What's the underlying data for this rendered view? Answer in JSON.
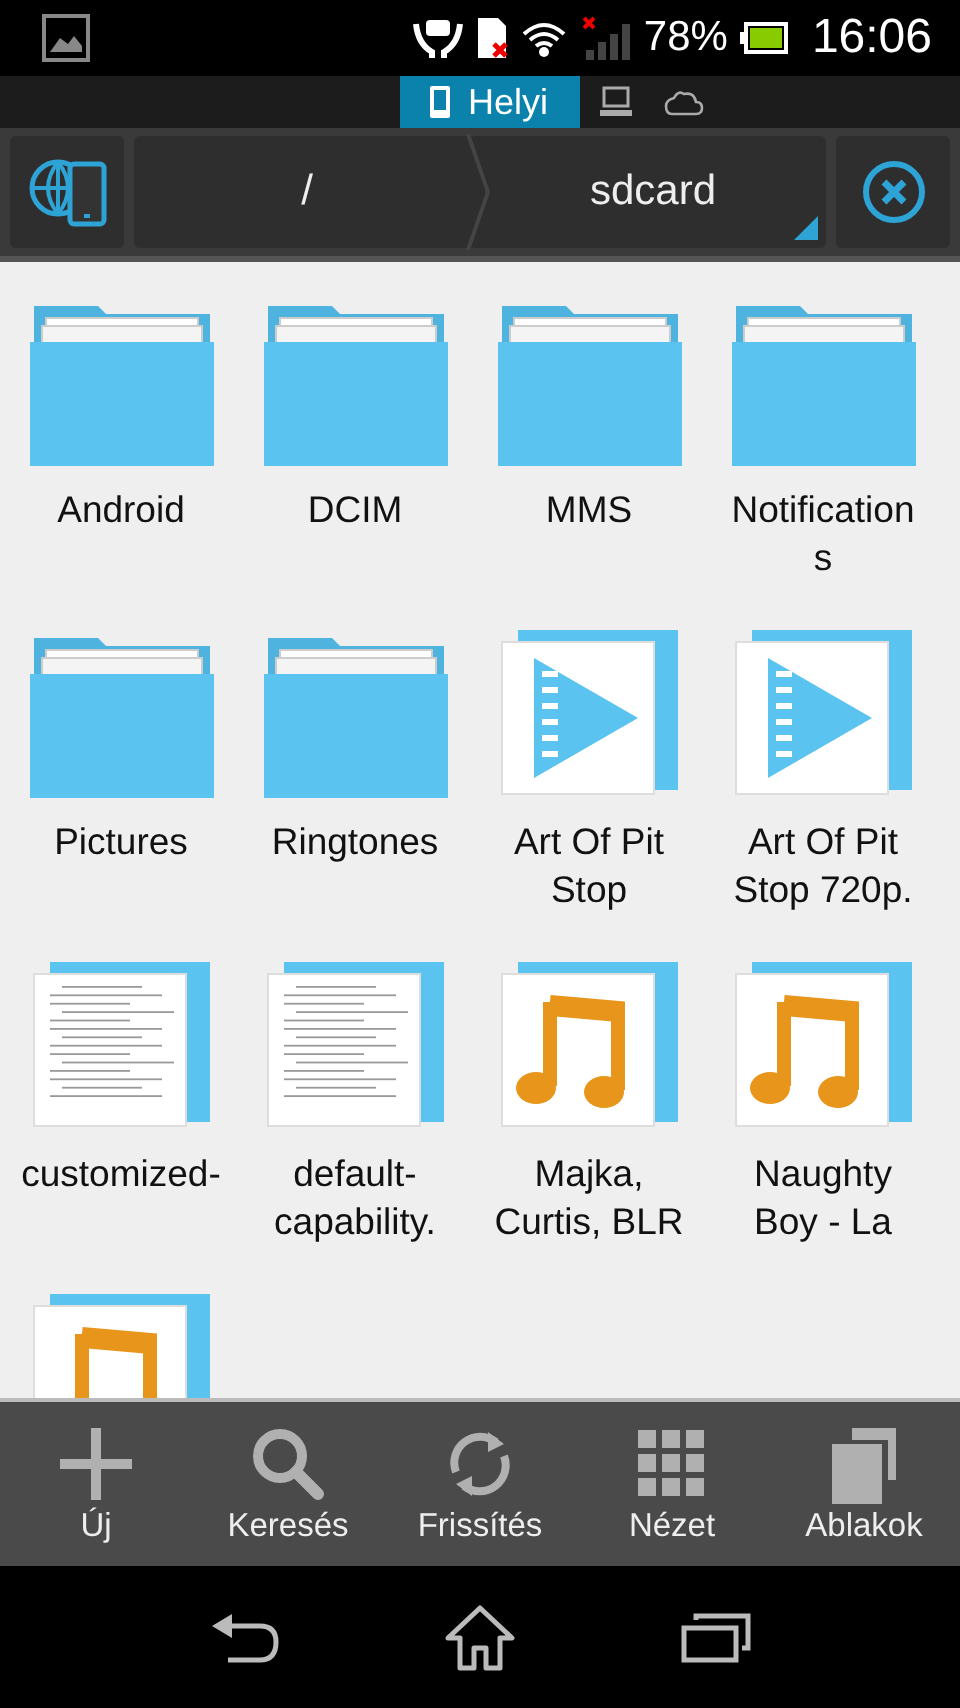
{
  "status_bar": {
    "battery": "78%",
    "time": "16:06"
  },
  "tabs": [
    {
      "kind": "phone",
      "label": "Helyi",
      "selected": true
    },
    {
      "kind": "computer",
      "selected": false
    },
    {
      "kind": "cloud",
      "selected": false
    }
  ],
  "path": {
    "segments": [
      "/",
      "sdcard"
    ]
  },
  "files": [
    {
      "kind": "folder",
      "name": "Android"
    },
    {
      "kind": "folder",
      "name": "DCIM"
    },
    {
      "kind": "folder",
      "name": "MMS"
    },
    {
      "kind": "folder",
      "name": "Notifications"
    },
    {
      "kind": "folder",
      "name": "Pictures"
    },
    {
      "kind": "folder",
      "name": "Ringtones"
    },
    {
      "kind": "video",
      "name": "Art Of Pit Stop"
    },
    {
      "kind": "video",
      "name": "Art Of Pit Stop 720p."
    },
    {
      "kind": "document",
      "name": "customized-"
    },
    {
      "kind": "document",
      "name": "default-capability."
    },
    {
      "kind": "audio",
      "name": "Majka, Curtis, BLR"
    },
    {
      "kind": "audio",
      "name": "Naughty Boy - La"
    },
    {
      "kind": "audio"
    }
  ],
  "toolbar": [
    {
      "kind": "new",
      "label": "Új"
    },
    {
      "kind": "search",
      "label": "Keresés"
    },
    {
      "kind": "refresh",
      "label": "Frissítés"
    },
    {
      "kind": "view",
      "label": "Nézet"
    },
    {
      "kind": "windows",
      "label": "Ablakok"
    }
  ]
}
